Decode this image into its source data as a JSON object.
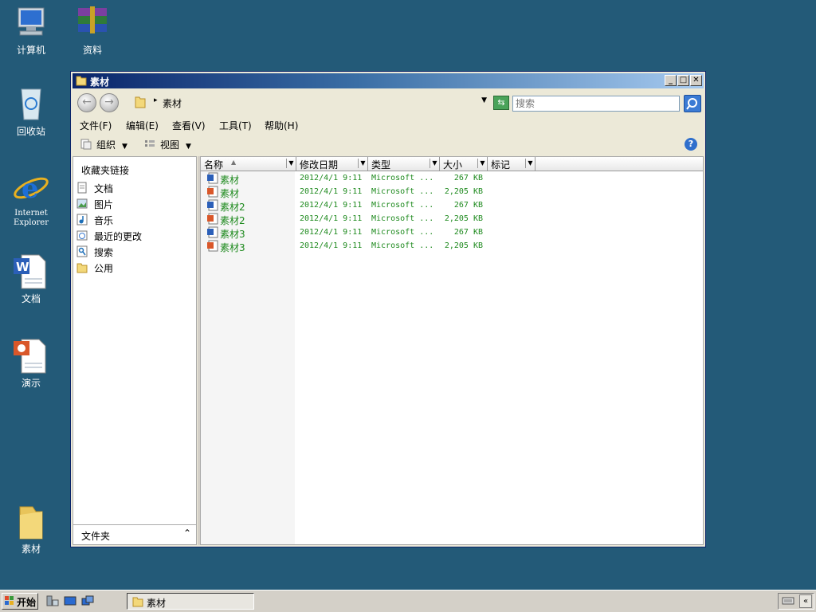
{
  "desktop": {
    "icons": [
      {
        "label": "计算机",
        "icon": "computer-icon"
      },
      {
        "label": "资料",
        "icon": "winrar-archive-icon"
      },
      {
        "label": "回收站",
        "icon": "recycle-bin-icon"
      },
      {
        "label": "Internet",
        "label2": "Explorer",
        "icon": "internet-explorer-icon"
      },
      {
        "label": "文档",
        "icon": "word-document-icon"
      },
      {
        "label": "演示",
        "icon": "powerpoint-document-icon"
      },
      {
        "label": "素材",
        "icon": "folder-icon"
      }
    ]
  },
  "window": {
    "title": "素材",
    "address_path": "素材",
    "search_placeholder": "搜索",
    "menu": [
      "文件(F)",
      "编辑(E)",
      "查看(V)",
      "工具(T)",
      "帮助(H)"
    ],
    "toolbar": {
      "organize": "组织",
      "views": "视图"
    },
    "left_pane": {
      "header": "收藏夹链接",
      "links": [
        {
          "label": "文档",
          "icon": "documents-icon"
        },
        {
          "label": "图片",
          "icon": "pictures-icon"
        },
        {
          "label": "音乐",
          "icon": "music-icon"
        },
        {
          "label": "最近的更改",
          "icon": "recent-changes-icon"
        },
        {
          "label": "搜索",
          "icon": "search-folder-icon"
        },
        {
          "label": "公用",
          "icon": "public-folder-icon"
        }
      ],
      "folders_label": "文件夹"
    },
    "columns": [
      "名称",
      "修改日期",
      "类型",
      "大小",
      "标记"
    ],
    "files": [
      {
        "name": "素材",
        "date": "2012/4/1 9:11",
        "type": "Microsoft ...",
        "size": "267 KB",
        "icon": "word-file-icon"
      },
      {
        "name": "素材",
        "date": "2012/4/1 9:11",
        "type": "Microsoft ...",
        "size": "2,205 KB",
        "icon": "powerpoint-file-icon"
      },
      {
        "name": "素材2",
        "date": "2012/4/1 9:11",
        "type": "Microsoft ...",
        "size": "267 KB",
        "icon": "word-file-icon"
      },
      {
        "name": "素材2",
        "date": "2012/4/1 9:11",
        "type": "Microsoft ...",
        "size": "2,205 KB",
        "icon": "powerpoint-file-icon"
      },
      {
        "name": "素材3",
        "date": "2012/4/1 9:11",
        "type": "Microsoft ...",
        "size": "267 KB",
        "icon": "word-file-icon"
      },
      {
        "name": "素材3",
        "date": "2012/4/1 9:11",
        "type": "Microsoft ...",
        "size": "2,205 KB",
        "icon": "powerpoint-file-icon"
      }
    ]
  },
  "taskbar": {
    "start_label": "开始",
    "task_label": "素材"
  },
  "colors": {
    "desktop": "#235a78",
    "file_text": "#1e8a1e",
    "title_gradient_start": "#0a246a"
  }
}
